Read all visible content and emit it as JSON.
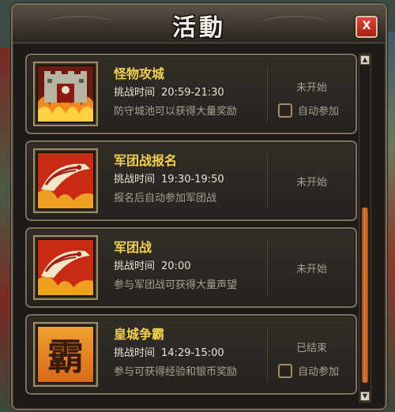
{
  "window": {
    "title": "活動",
    "close_label": "X"
  },
  "activities": [
    {
      "icon": "castle-siege-icon",
      "name": "怪物攻城",
      "time_label": "挑战时间",
      "time": "20:59-21:30",
      "description": "防守城池可以获得大量奖励",
      "status": "未开始",
      "auto_join_label": "自动参加"
    },
    {
      "icon": "dragon-banner-icon",
      "name": "军团战报名",
      "time_label": "挑战时间",
      "time": "19:30-19:50",
      "description": "报名后自动参加军团战",
      "status": "未开始"
    },
    {
      "icon": "dragon-banner-icon",
      "name": "军团战",
      "time_label": "挑战时间",
      "time": "20:00",
      "description": "参与军团战可获得大量声望",
      "status": "未开始"
    },
    {
      "icon": "ba-character-icon",
      "icon_text": "霸",
      "name": "皇城争霸",
      "time_label": "挑战时间",
      "time": "14:29-15:00",
      "description": "参与可获得经验和银币奖励",
      "status": "已结束",
      "auto_join_label": "自动参加"
    }
  ],
  "scrollbar": {
    "up_glyph": "▲",
    "down_glyph": "▼"
  },
  "colors": {
    "title_text": "#f4efe6",
    "activity_name": "#f2d24a",
    "close_button": "#c0281c",
    "scroll_thumb": "#e07e30"
  }
}
